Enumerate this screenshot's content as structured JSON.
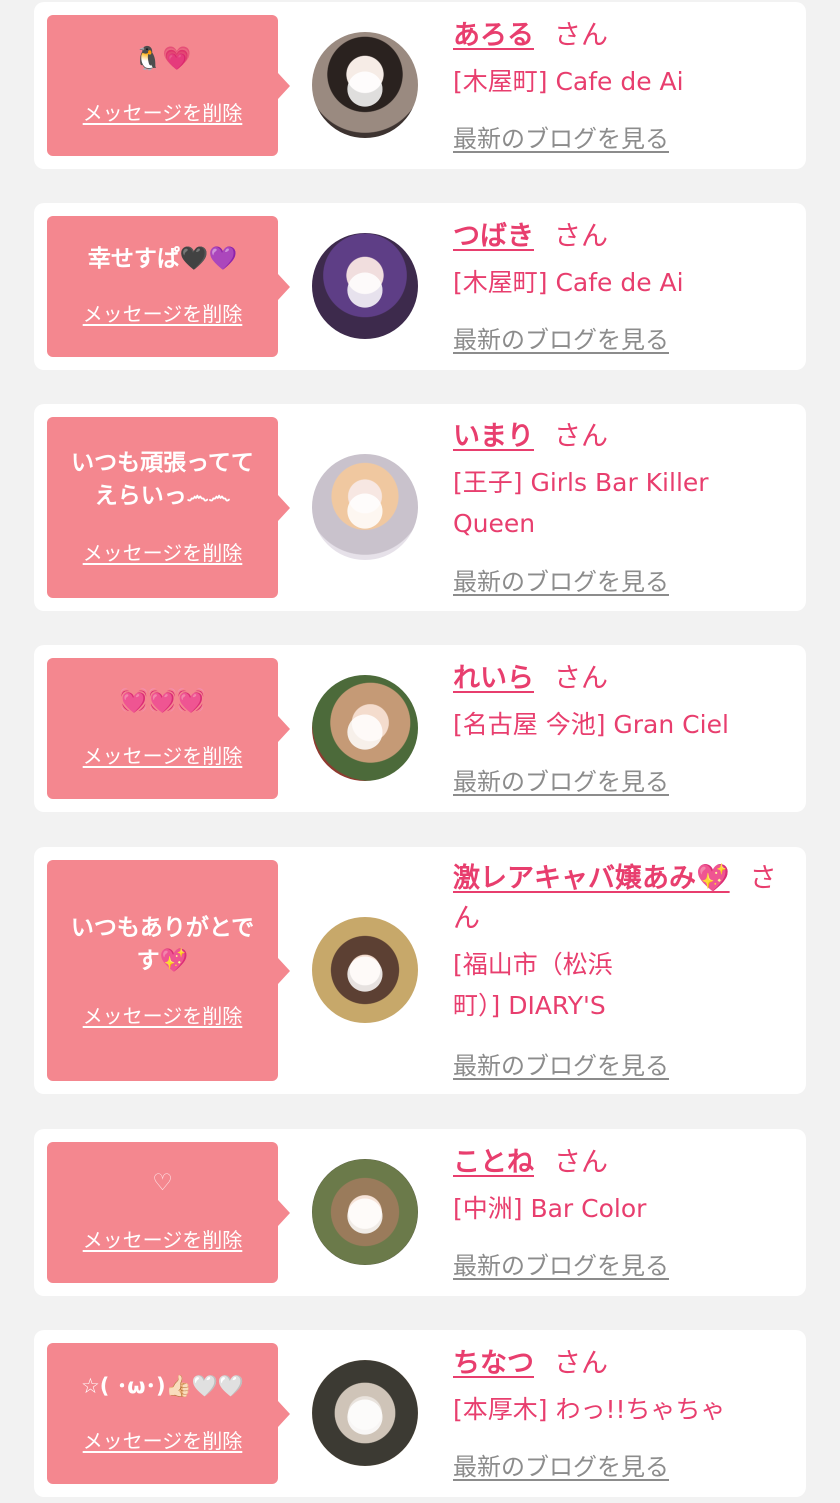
{
  "common": {
    "delete_label": "メッセージを削除",
    "san_label": "さん",
    "blog_label": "最新のブログを見る"
  },
  "entries": [
    {
      "message": "🐧💗",
      "name": "あろる",
      "shop": "[木屋町] Cafe de Ai",
      "avatar_icon": "person-photo-icon"
    },
    {
      "message": "幸せすぱ🖤💜",
      "name": "つばき",
      "shop": "[木屋町] Cafe de Ai",
      "avatar_icon": "person-photo-icon"
    },
    {
      "message": "いつも頑張ってて\nえらいっ෴෴",
      "name": "いまり",
      "shop": "[王子] Girls Bar Killer\nQueen",
      "avatar_icon": "person-photo-icon"
    },
    {
      "message": "💓💓💓",
      "name": "れいら",
      "shop": "[名古屋 今池] Gran Ciel",
      "avatar_icon": "person-photo-icon"
    },
    {
      "message": "いつもありがとで\nす💖",
      "name": "激レアキャバ嬢あみ💖",
      "shop": "[福山市（松浜\n町）] DIARY'S",
      "avatar_icon": "person-photo-icon"
    },
    {
      "message": "♡",
      "name": "ことね",
      "shop": "[中洲] Bar Color",
      "avatar_icon": "person-photo-icon"
    },
    {
      "message": "☆( ･ω･)👍🏻🤍🤍",
      "name": "ちなつ",
      "shop": "[本厚木] わっ!!ちゃちゃ",
      "avatar_icon": "person-photo-icon"
    }
  ]
}
